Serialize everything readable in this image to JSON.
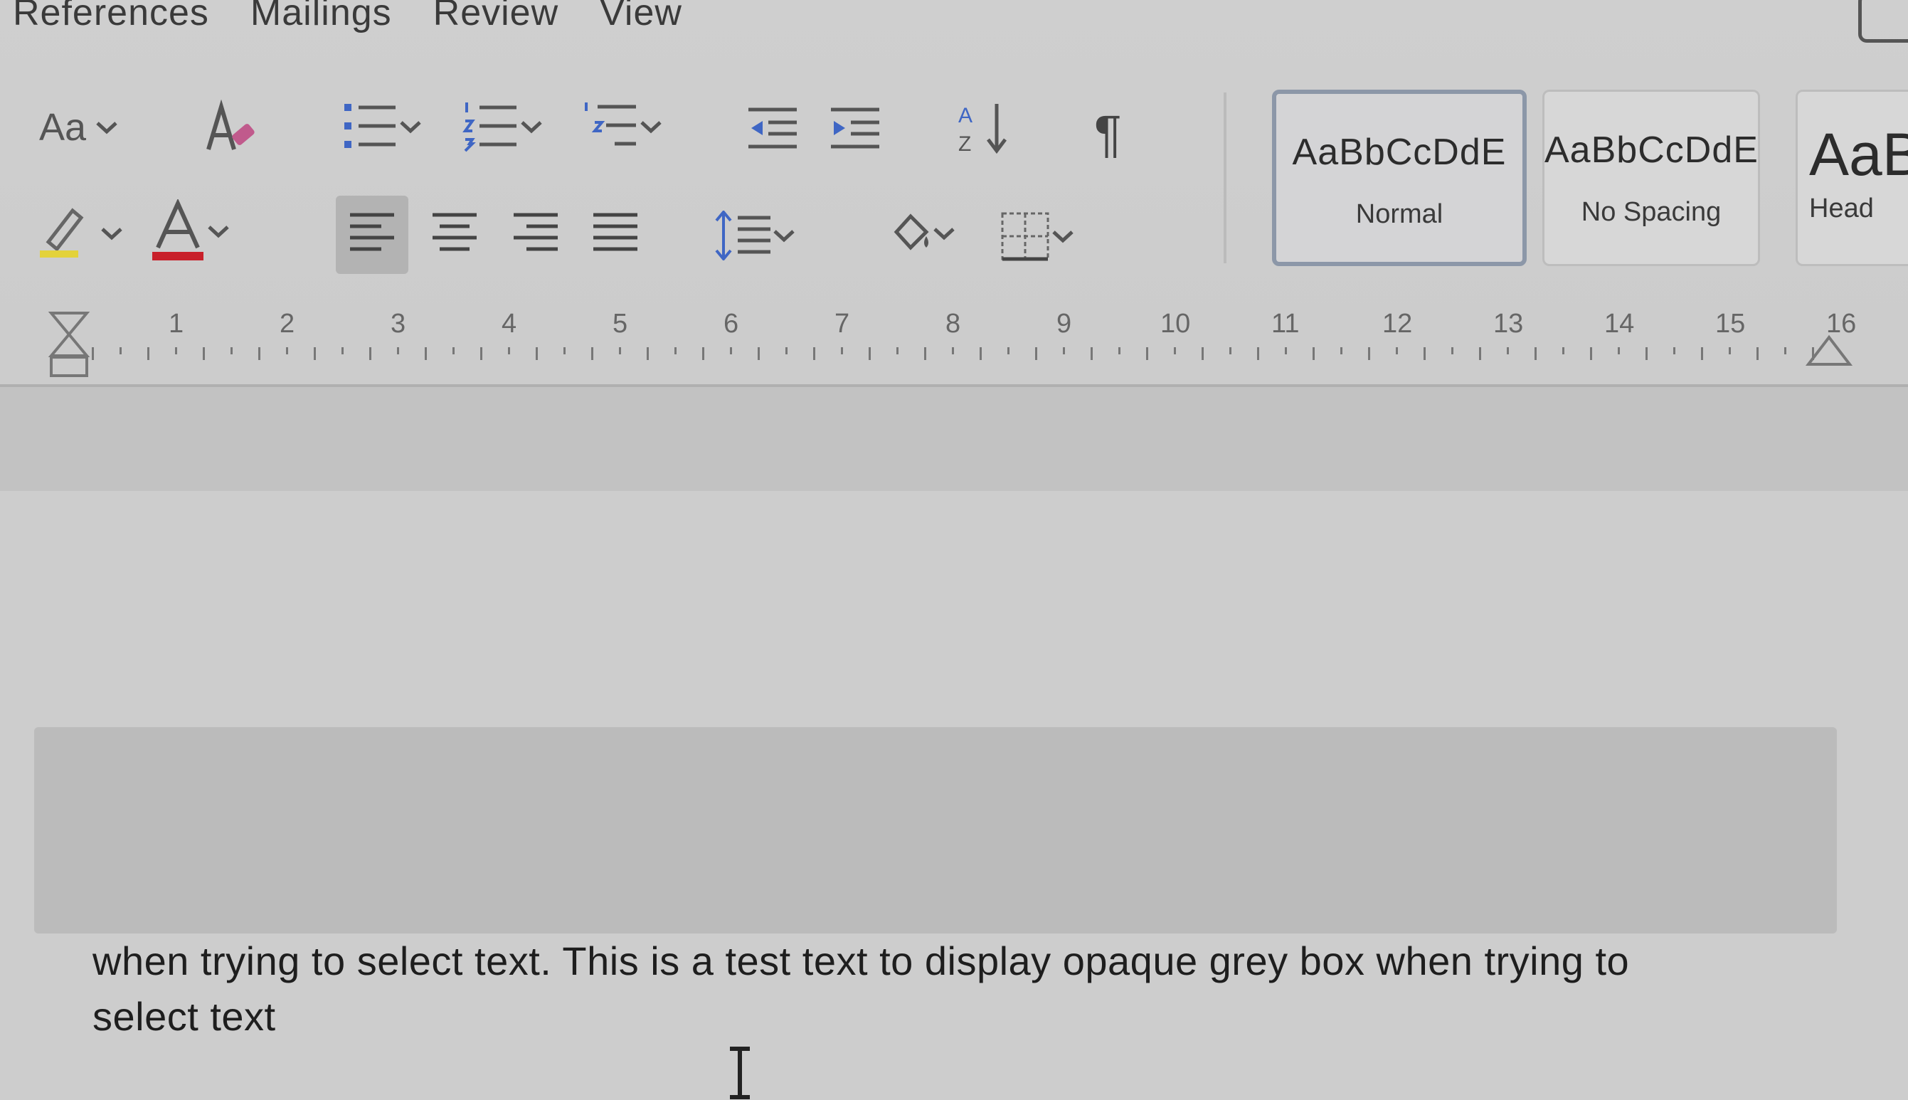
{
  "menu": {
    "tabs": [
      "References",
      "Mailings",
      "Review",
      "View"
    ]
  },
  "ribbon": {
    "font_size_label": "Aa",
    "styles": [
      {
        "sample": "AaBbCcDdE",
        "name": "Normal"
      },
      {
        "sample": "AaBbCcDdE",
        "name": "No Spacing"
      },
      {
        "sample": "AaB",
        "name": "Head"
      }
    ]
  },
  "ruler": {
    "numbers": [
      "1",
      "2",
      "3",
      "4",
      "5",
      "6",
      "7",
      "8",
      "9",
      "10",
      "11",
      "12",
      "13",
      "14",
      "15",
      "16"
    ]
  },
  "document": {
    "line1": "when trying to select text. This is a test text to display opaque grey box when trying to",
    "line2": "select text"
  },
  "colors": {
    "font_color_bar": "#c8202a",
    "highlight_bar": "#e3d23a",
    "selected_style_border": "#8c97a8"
  }
}
